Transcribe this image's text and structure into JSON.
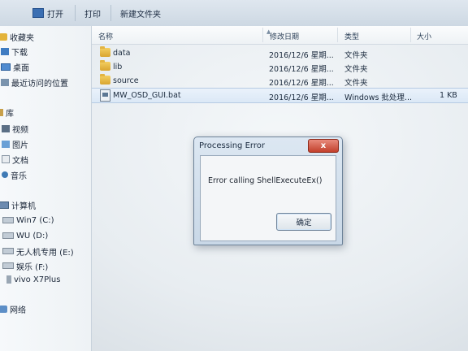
{
  "toolbar": {
    "open_label": "打开",
    "print_label": "打印",
    "new_folder_label": "新建文件夹"
  },
  "nav": {
    "favorites": "收藏夹",
    "favorites_items": [
      "下载",
      "桌面",
      "最近访问的位置"
    ],
    "libraries": "库",
    "libraries_items": [
      "视频",
      "图片",
      "文档",
      "音乐"
    ],
    "computer": "计算机",
    "computer_items": [
      "Win7 (C:)",
      "WU (D:)",
      "无人机专用 (E:)",
      "娱乐 (F:)",
      "vivo X7Plus"
    ],
    "network": "网络"
  },
  "columns": {
    "name": "名称",
    "modified": "修改日期",
    "type": "类型",
    "size": "大小"
  },
  "files": [
    {
      "name": "data",
      "modified": "2016/12/6 星期...",
      "type": "文件夹",
      "size": "",
      "icon": "folder-icon"
    },
    {
      "name": "lib",
      "modified": "2016/12/6 星期...",
      "type": "文件夹",
      "size": "",
      "icon": "folder-icon"
    },
    {
      "name": "source",
      "modified": "2016/12/6 星期...",
      "type": "文件夹",
      "size": "",
      "icon": "folder-icon"
    },
    {
      "name": "MW_OSD_GUI.bat",
      "modified": "2016/12/6 星期...",
      "type": "Windows 批处理...",
      "size": "1 KB",
      "icon": "bat-file-icon"
    }
  ],
  "dialog": {
    "title": "Processing Error",
    "close_label": "x",
    "message": "Error calling ShellExecuteEx()",
    "ok_label": "确定"
  }
}
